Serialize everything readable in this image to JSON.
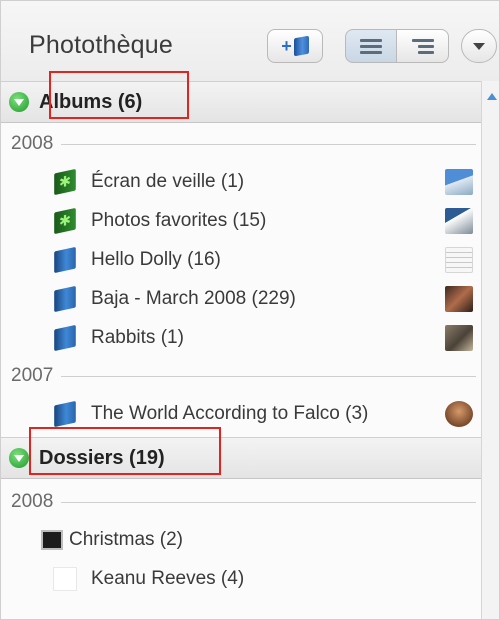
{
  "header": {
    "title": "Photothèque",
    "icons": {
      "new_album": "new-album-icon",
      "list_view": "list-view-icon",
      "tree_view": "tree-view-icon",
      "menu": "chevron-down-icon"
    }
  },
  "albums_section": {
    "label": "Albums (6)"
  },
  "album_groups": [
    {
      "year": "2008",
      "items": [
        {
          "label": "Écran de veille (1)",
          "icon": "smart-album-icon"
        },
        {
          "label": "Photos favorites (15)",
          "icon": "smart-album-icon"
        },
        {
          "label": "Hello Dolly (16)",
          "icon": "album-icon"
        },
        {
          "label": "Baja - March 2008 (229)",
          "icon": "album-icon"
        },
        {
          "label": "Rabbits (1)",
          "icon": "album-icon"
        }
      ]
    },
    {
      "year": "2007",
      "items": [
        {
          "label": "The World According to Falco (3)",
          "icon": "album-icon"
        }
      ]
    }
  ],
  "folders_section": {
    "label": "Dossiers (19)"
  },
  "folder_groups": [
    {
      "year": "2008",
      "items": [
        {
          "label": "Christmas (2)",
          "icon": "folder-thumbnail-icon"
        },
        {
          "label": "Keanu Reeves (4)",
          "icon": "folder-thumbnail-icon"
        }
      ]
    }
  ],
  "colors": {
    "highlight": "#e1241f",
    "album_blue": "#3f88d6",
    "smart_green": "#2f8d2f",
    "disclosure_green": "#1e9a2a"
  }
}
